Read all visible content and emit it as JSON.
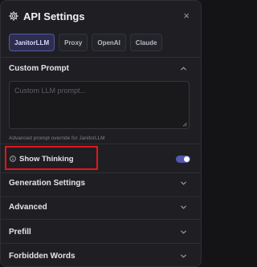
{
  "header": {
    "title": "API Settings",
    "gear_icon": "gear-icon",
    "close": "×"
  },
  "tabs": [
    {
      "label": "JanitorLLM",
      "active": true
    },
    {
      "label": "Proxy",
      "active": false
    },
    {
      "label": "OpenAI",
      "active": false
    },
    {
      "label": "Claude",
      "active": false
    }
  ],
  "custom_prompt": {
    "label": "Custom Prompt",
    "expanded": true,
    "placeholder": "Custom LLM prompt...",
    "value": "",
    "helper": "Advanced prompt override for JanitorLLM"
  },
  "show_thinking": {
    "label": "Show Thinking",
    "icon": "info-icon",
    "enabled": true
  },
  "sections": {
    "generation": "Generation Settings",
    "advanced": "Advanced",
    "prefill": "Prefill",
    "forbidden": "Forbidden Words"
  },
  "colors": {
    "accent": "#5457b0",
    "highlight": "#e0161b",
    "panel": "#1f1f23"
  }
}
